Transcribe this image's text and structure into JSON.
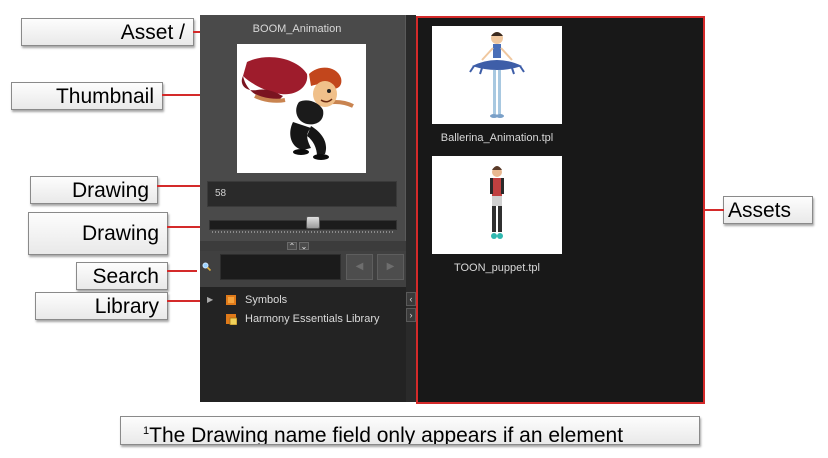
{
  "callouts": {
    "asset": "Asset /",
    "thumbnail": "Thumbnail",
    "drawing_name": "Drawing",
    "drawing_slider": "Drawing",
    "search": "Search",
    "library": "Library",
    "assets": "Assets"
  },
  "preview": {
    "asset_name": "BOOM_Animation",
    "drawing_name_value": "58"
  },
  "library_tree": [
    {
      "label": "Symbols",
      "expandable": true
    },
    {
      "label": "Harmony Essentials Library",
      "expandable": false
    }
  ],
  "assets": [
    {
      "label": "Ballerina_Animation.tpl"
    },
    {
      "label": "TOON_puppet.tpl"
    }
  ],
  "footnote": {
    "marker": "1",
    "text": "The Drawing name field only appears if an element"
  },
  "colors": {
    "leader": "#d42a2a",
    "panel_bg": "#4a4a4a",
    "assets_bg": "#181818"
  }
}
